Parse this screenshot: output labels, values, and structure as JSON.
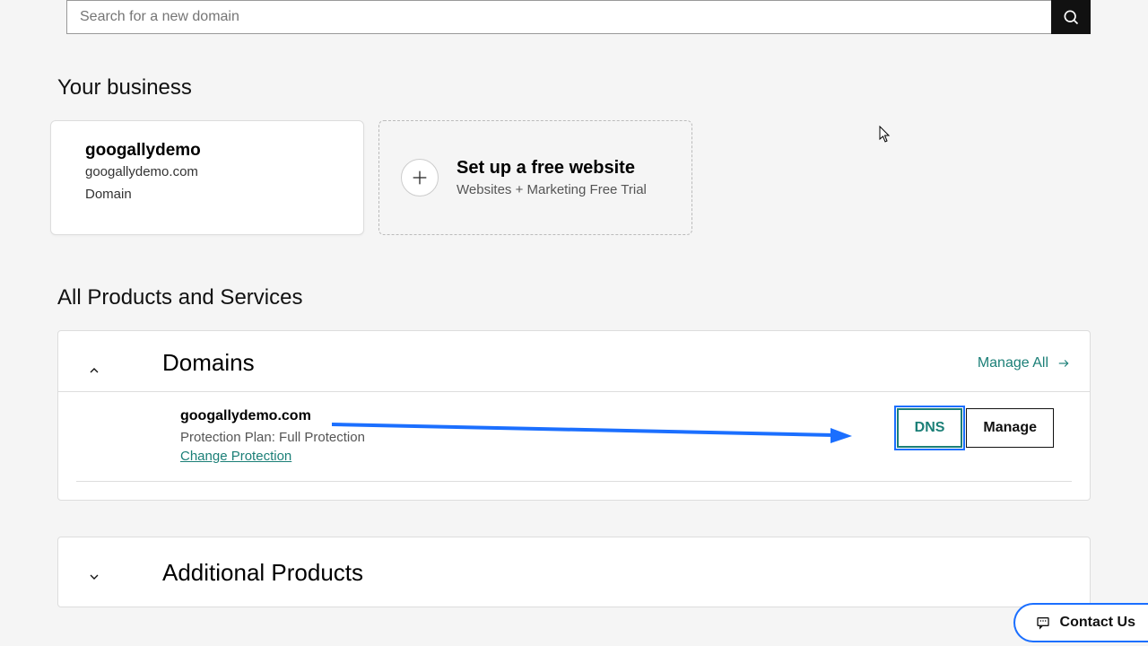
{
  "search": {
    "placeholder": "Search for a new domain"
  },
  "sections": {
    "your_business": "Your business",
    "all_products": "All Products and Services"
  },
  "business_card": {
    "title": "googallydemo",
    "domain": "googallydemo.com",
    "type": "Domain"
  },
  "setup_card": {
    "title": "Set up a free website",
    "sub": "Websites + Marketing Free Trial"
  },
  "domains_panel": {
    "heading": "Domains",
    "manage_all": "Manage All"
  },
  "domain_row": {
    "name": "googallydemo.com",
    "plan": "Protection Plan: Full Protection",
    "change": "Change Protection",
    "dns": "DNS",
    "manage": "Manage"
  },
  "additional_panel": {
    "heading": "Additional Products"
  },
  "contact": {
    "label": "Contact Us"
  }
}
